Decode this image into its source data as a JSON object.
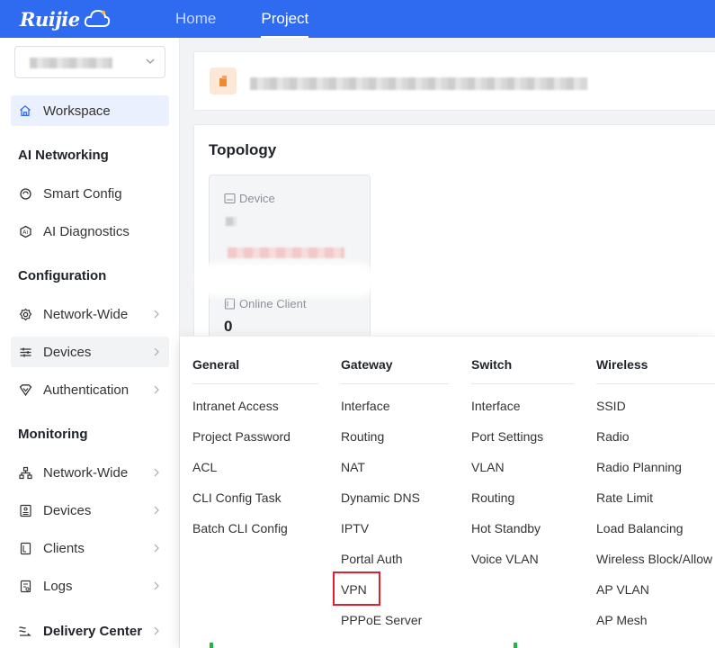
{
  "topbar": {
    "logo_text": "Ruijie",
    "tabs": [
      {
        "label": "Home",
        "active": false
      },
      {
        "label": "Project",
        "active": true
      }
    ],
    "color": "#2f6bf0"
  },
  "sidebar": {
    "workspace": "Workspace",
    "sections": {
      "ai": "AI Networking",
      "config": "Configuration",
      "monitoring": "Monitoring"
    },
    "items": {
      "smart_config": "Smart Config",
      "ai_diagnostics": "AI Diagnostics",
      "network_wide": "Network-Wide",
      "devices": "Devices",
      "authentication": "Authentication",
      "mon_network_wide": "Network-Wide",
      "mon_devices": "Devices",
      "clients": "Clients",
      "logs": "Logs",
      "delivery_center": "Delivery Center"
    }
  },
  "main": {
    "topology_title": "Topology",
    "device_label": "Device",
    "online_client_label": "Online Client",
    "online_client_value": "0"
  },
  "menu": {
    "general": {
      "title": "General",
      "items": [
        "Intranet Access",
        "Project Password",
        "ACL",
        "CLI Config Task",
        "Batch CLI Config"
      ]
    },
    "gateway": {
      "title": "Gateway",
      "items": [
        "Interface",
        "Routing",
        "NAT",
        "Dynamic DNS",
        "IPTV",
        "Portal Auth",
        "VPN",
        "PPPoE Server"
      ]
    },
    "switch": {
      "title": "Switch",
      "items": [
        "Interface",
        "Port Settings",
        "VLAN",
        "Routing",
        "Hot Standby",
        "Voice VLAN"
      ]
    },
    "wireless": {
      "title": "Wireless",
      "items": [
        "SSID",
        "Radio",
        "Radio Planning",
        "Rate Limit",
        "Load Balancing",
        "Wireless Block/Allow",
        "AP VLAN",
        "AP Mesh"
      ]
    },
    "highlight_color": "#e0202e"
  }
}
